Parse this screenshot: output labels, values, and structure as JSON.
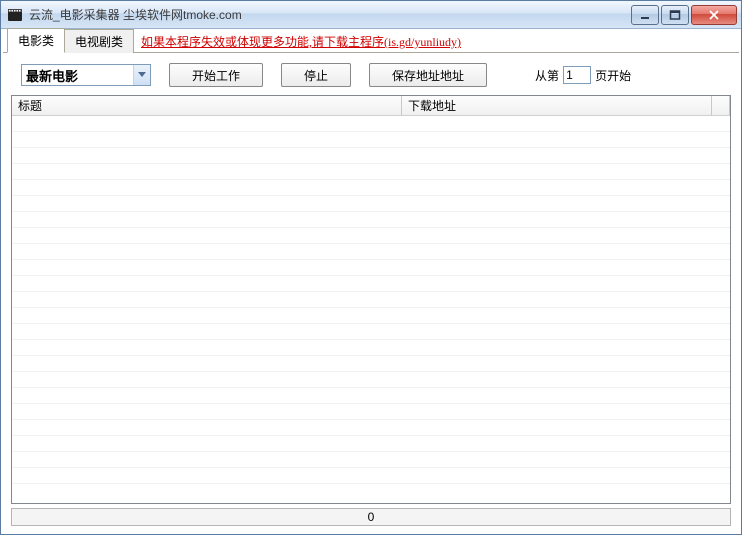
{
  "title": "云流_电影采集器  尘埃软件网tmoke.com",
  "tabs": {
    "movie": "电影类",
    "tv": "电视剧类",
    "link": "如果本程序失效或体现更多功能,请下载主程序(is.gd/yunliudy)"
  },
  "toolbar": {
    "dropdown_value": "最新电影",
    "start_label": "开始工作",
    "stop_label": "停止",
    "save_label": "保存地址地址",
    "page_prefix": "从第",
    "page_value": "1",
    "page_suffix": "页开始"
  },
  "columns": {
    "title": "标题",
    "download": "下载地址"
  },
  "progress": {
    "text": "0"
  }
}
